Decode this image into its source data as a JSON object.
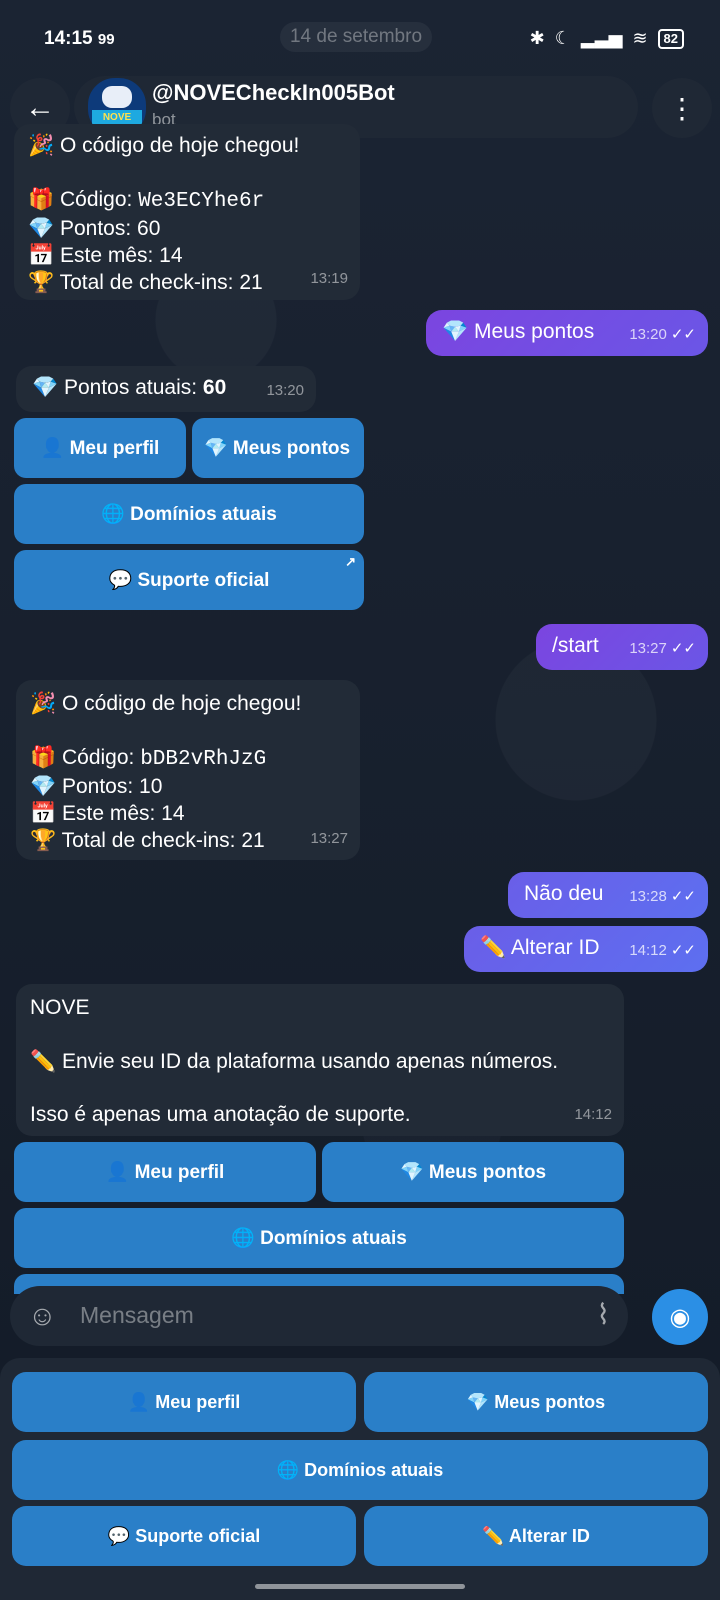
{
  "status": {
    "time": "14:15",
    "notif": "99",
    "date_pill": "14 de setembro",
    "battery": "82"
  },
  "header": {
    "title": "@NOVECheckIn005Bot",
    "subtitle": "bot",
    "avatar_text": "NOVE"
  },
  "messages": {
    "m1": {
      "line1": "🎉 O código de hoje chegou!",
      "code_prefix": "🎁 Código: ",
      "code": "We3ECYhe6r",
      "points": "💎 Pontos: 60",
      "month": "📅 Este mês: 14",
      "total": "🏆 Total de check-ins: 21",
      "time": "13:19"
    },
    "m2": {
      "text": "💎 Meus pontos",
      "time": "13:20"
    },
    "m3": {
      "text_prefix": "💎 Pontos atuais: ",
      "text_value": "60",
      "time": "13:20"
    },
    "m3_buttons": {
      "profile": "👤 Meu perfil",
      "points": "💎 Meus pontos",
      "domains": "🌐 Domínios atuais",
      "support": "💬 Suporte oficial",
      "support_arrow": "↗"
    },
    "m4": {
      "text": "/start",
      "time": "13:27"
    },
    "m5": {
      "line1": "🎉 O código de hoje chegou!",
      "code_prefix": "🎁 Código: ",
      "code": "bDB2vRhJzG",
      "points": "💎 Pontos: 10",
      "month": "📅 Este mês: 14",
      "total": "🏆 Total de check-ins: 21",
      "time": "13:27"
    },
    "m6": {
      "text": "Não deu",
      "time": "13:28"
    },
    "m7": {
      "text": "✏️ Alterar ID",
      "time": "14:12"
    },
    "m8": {
      "title": "NOVE",
      "line1": "✏️ Envie seu ID da plataforma usando apenas números.",
      "line2": "Isso é apenas uma anotação de suporte.",
      "time": "14:12"
    },
    "m8_buttons": {
      "profile": "👤 Meu perfil",
      "points": "💎 Meus pontos",
      "domains": "🌐 Domínios atuais"
    }
  },
  "composer": {
    "placeholder": "Mensagem"
  },
  "keyboard": {
    "profile": "👤 Meu perfil",
    "points": "💎 Meus pontos",
    "domains": "🌐 Domínios atuais",
    "support": "💬 Suporte oficial",
    "change_id": "✏️ Alterar ID"
  },
  "icons": {
    "back": "arrow-left-icon",
    "menu": "more-vert-icon",
    "sticker": "sticker-icon",
    "attach": "paperclip-icon",
    "camera": "camera-icon",
    "read": "double-check-icon"
  },
  "colors": {
    "background": "#141d2b",
    "incoming": "#222b37",
    "outgoing": "#7b45e0",
    "button": "#2a7fc8",
    "accent": "#2b8fe5"
  }
}
